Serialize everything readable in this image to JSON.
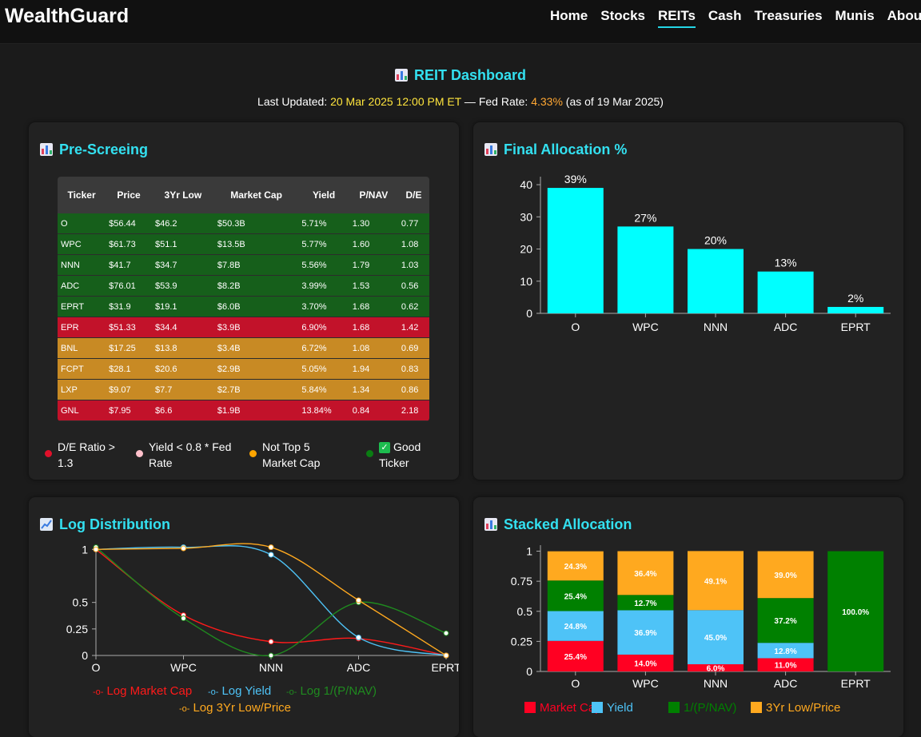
{
  "app": {
    "logo": "WealthGuard",
    "nav": [
      {
        "label": "Home",
        "active": false
      },
      {
        "label": "Stocks",
        "active": false
      },
      {
        "label": "REITs",
        "active": true
      },
      {
        "label": "Cash",
        "active": false
      },
      {
        "label": "Treasuries",
        "active": false
      },
      {
        "label": "Munis",
        "active": false
      },
      {
        "label": "Abou",
        "active": false
      }
    ]
  },
  "header": {
    "title": "REIT Dashboard",
    "updated_prefix": "Last Updated: ",
    "updated_value": "20 Mar 2025 12:00 PM ET",
    "fed_prefix": " — Fed Rate: ",
    "fed_value": "4.33%",
    "fed_suffix": " (as of 19 Mar 2025)"
  },
  "colors": {
    "accent": "#33e0f0",
    "good": "#165f1b",
    "red": "#c2122a",
    "amber": "#c88a24",
    "bar": "#00ffff",
    "market_cap": "#ff0000",
    "yield": "#4ec3f7",
    "inv_pnav": "#008000",
    "low_price": "#ffa91f"
  },
  "prescreen": {
    "title": "Pre-Screeing",
    "icon": "bar-chart-icon",
    "headers": [
      "Ticker",
      "Price",
      "3Yr Low",
      "Market Cap",
      "Yield",
      "P/NAV",
      "D/E"
    ],
    "rows": [
      {
        "status": "good",
        "cells": [
          "O",
          "$56.44",
          "$46.2",
          "$50.3B",
          "5.71%",
          "1.30",
          "0.77"
        ]
      },
      {
        "status": "good",
        "cells": [
          "WPC",
          "$61.73",
          "$51.1",
          "$13.5B",
          "5.77%",
          "1.60",
          "1.08"
        ]
      },
      {
        "status": "good",
        "cells": [
          "NNN",
          "$41.7",
          "$34.7",
          "$7.8B",
          "5.56%",
          "1.79",
          "1.03"
        ]
      },
      {
        "status": "good",
        "cells": [
          "ADC",
          "$76.01",
          "$53.9",
          "$8.2B",
          "3.99%",
          "1.53",
          "0.56"
        ]
      },
      {
        "status": "good",
        "cells": [
          "EPRT",
          "$31.9",
          "$19.1",
          "$6.0B",
          "3.70%",
          "1.68",
          "0.62"
        ]
      },
      {
        "status": "red",
        "cells": [
          "EPR",
          "$51.33",
          "$34.4",
          "$3.9B",
          "6.90%",
          "1.68",
          "1.42"
        ]
      },
      {
        "status": "amber",
        "cells": [
          "BNL",
          "$17.25",
          "$13.8",
          "$3.4B",
          "6.72%",
          "1.08",
          "0.69"
        ]
      },
      {
        "status": "amber",
        "cells": [
          "FCPT",
          "$28.1",
          "$20.6",
          "$2.9B",
          "5.05%",
          "1.94",
          "0.83"
        ]
      },
      {
        "status": "amber",
        "cells": [
          "LXP",
          "$9.07",
          "$7.7",
          "$2.7B",
          "5.84%",
          "1.34",
          "0.86"
        ]
      },
      {
        "status": "red",
        "cells": [
          "GNL",
          "$7.95",
          "$6.6",
          "$1.9B",
          "13.84%",
          "0.84",
          "2.18"
        ]
      }
    ],
    "legend": [
      {
        "color": "#e0102a",
        "line1": "D/E Ratio >",
        "line2": "1.3"
      },
      {
        "color": "#ffc0cb",
        "line1": "Yield < 0.8 * Fed",
        "line2": "Rate"
      },
      {
        "color": "#ffa500",
        "line1": "Not Top 5",
        "line2": "Market Cap"
      },
      {
        "color": "#0a7d12",
        "line1": "Good",
        "line2": "Ticker",
        "check": true
      }
    ]
  },
  "final_allocation": {
    "title": "Final Allocation %",
    "icon": "bar-chart-icon"
  },
  "log_distribution": {
    "title": "Log Distribution",
    "icon": "line-chart-icon"
  },
  "stacked_allocation": {
    "title": "Stacked Allocation",
    "icon": "bar-chart-icon"
  },
  "chart_data": [
    {
      "id": "final",
      "type": "bar",
      "categories": [
        "O",
        "WPC",
        "NNN",
        "ADC",
        "EPRT"
      ],
      "values": [
        39,
        27,
        20,
        13,
        2
      ],
      "data_labels": [
        "39%",
        "27%",
        "20%",
        "13%",
        "2%"
      ],
      "yticks": [
        0,
        10,
        20,
        30,
        40
      ],
      "ylim": [
        0,
        42
      ],
      "color": "#00ffff"
    },
    {
      "id": "log",
      "type": "line",
      "categories": [
        "O",
        "WPC",
        "NNN",
        "ADC",
        "EPRT"
      ],
      "yticks": [
        0,
        0.25,
        0.5,
        1
      ],
      "ytick_labels": [
        "0",
        "0.25",
        "0.5",
        "1"
      ],
      "ylim": [
        0,
        1.04
      ],
      "series": [
        {
          "name": "Log Market Cap",
          "color": "#ff1a1a",
          "values": [
            1.0,
            0.38,
            0.13,
            0.16,
            0.0
          ]
        },
        {
          "name": "Log Yield",
          "color": "#4ec3f7",
          "values": [
            1.0,
            1.02,
            0.95,
            0.17,
            0.0
          ]
        },
        {
          "name": "Log 1/(P/NAV)",
          "color": "#1f8a1f",
          "values": [
            1.02,
            0.35,
            0.0,
            0.5,
            0.21
          ]
        },
        {
          "name": "Log 3Yr Low/Price",
          "color": "#ffa91f",
          "values": [
            1.0,
            1.01,
            1.02,
            0.52,
            0.0
          ]
        }
      ],
      "legend": "bottom"
    },
    {
      "id": "stacked",
      "type": "bar",
      "stacked": true,
      "categories": [
        "O",
        "WPC",
        "NNN",
        "ADC",
        "EPRT"
      ],
      "yticks": [
        0,
        0.25,
        0.5,
        0.75,
        1
      ],
      "ytick_labels": [
        "0",
        "0.25",
        "0.5",
        "0.75",
        "1"
      ],
      "ylim": [
        0,
        1.05
      ],
      "series": [
        {
          "name": "Market Cap",
          "color": "#ff0022",
          "values": [
            0.254,
            0.14,
            0.06,
            0.11,
            0
          ],
          "labels": [
            "25.4%",
            "14.0%",
            "6.0%",
            "11.0%",
            ""
          ]
        },
        {
          "name": "Yield",
          "color": "#4ec3f7",
          "values": [
            0.248,
            0.369,
            0.45,
            0.128,
            0
          ],
          "labels": [
            "24.8%",
            "36.9%",
            "45.0%",
            "12.8%",
            ""
          ]
        },
        {
          "name": "1/(P/NAV)",
          "color": "#008000",
          "values": [
            0.254,
            0.127,
            0,
            0.372,
            1.0
          ],
          "labels": [
            "25.4%",
            "12.7%",
            "",
            "37.2%",
            "100.0%"
          ]
        },
        {
          "name": "3Yr Low/Price",
          "color": "#ffa91f",
          "values": [
            0.243,
            0.364,
            0.491,
            0.39,
            0
          ],
          "labels": [
            "24.3%",
            "36.4%",
            "49.1%",
            "39.0%",
            ""
          ]
        }
      ],
      "legend": "bottom"
    }
  ]
}
